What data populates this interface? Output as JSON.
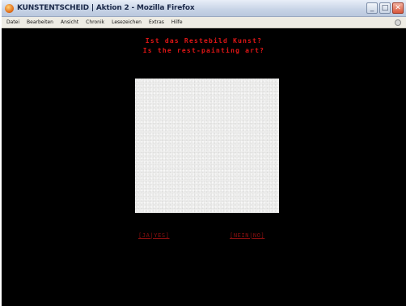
{
  "window": {
    "title": "KUNSTENTSCHEID | Aktion 2 - Mozilla Firefox",
    "controls": {
      "minimize": "_",
      "maximize": "□",
      "close": "✕"
    }
  },
  "menubar": {
    "items": [
      "Datei",
      "Bearbeiten",
      "Ansicht",
      "Chronik",
      "Lesezeichen",
      "Extras",
      "Hilfe"
    ]
  },
  "page": {
    "question_de": "Ist das Restebild Kunst?",
    "question_en": "Is the rest-painting art?",
    "yes_label": "[JA|YES]",
    "no_label": "[NEIN|NO]"
  },
  "colors": {
    "background": "#000000",
    "heading": "#e01616",
    "answer_link": "#8a1010",
    "painting": "#efefee"
  }
}
